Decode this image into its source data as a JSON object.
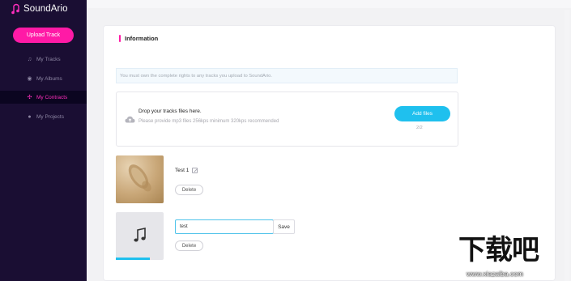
{
  "app": {
    "name": "SoundArio"
  },
  "sidebar": {
    "upload_label": "Upload Track",
    "items": [
      {
        "label": "My Tracks",
        "icon": "music-note-icon",
        "active": false
      },
      {
        "label": "My Albums",
        "icon": "disc-icon",
        "active": false
      },
      {
        "label": "My Contracts",
        "icon": "contracts-icon",
        "active": true
      },
      {
        "label": "My Projects",
        "icon": "user-icon",
        "active": false
      }
    ]
  },
  "main": {
    "section_title": "Information",
    "notice": "You must own the complete rights to any tracks you upload to SoundArio.",
    "dropzone": {
      "title": "Drop your tracks files here.",
      "subtitle": "Please provide mp3 files 256kps minimum 320kps recommended",
      "button": "Add files",
      "count": "2/2"
    },
    "tracks": [
      {
        "title": "Test 1",
        "delete_label": "Delete"
      },
      {
        "input_value": "test",
        "save_label": "Save",
        "delete_label": "Delete",
        "upload_progress": 0.72
      }
    ]
  },
  "watermark": {
    "text": "下载吧",
    "url": "www.xiazaiba.com"
  },
  "colors": {
    "sidebar_bg": "#1a0e33",
    "accent_pink": "#ff1aa6",
    "accent_blue": "#1fc0ee"
  }
}
